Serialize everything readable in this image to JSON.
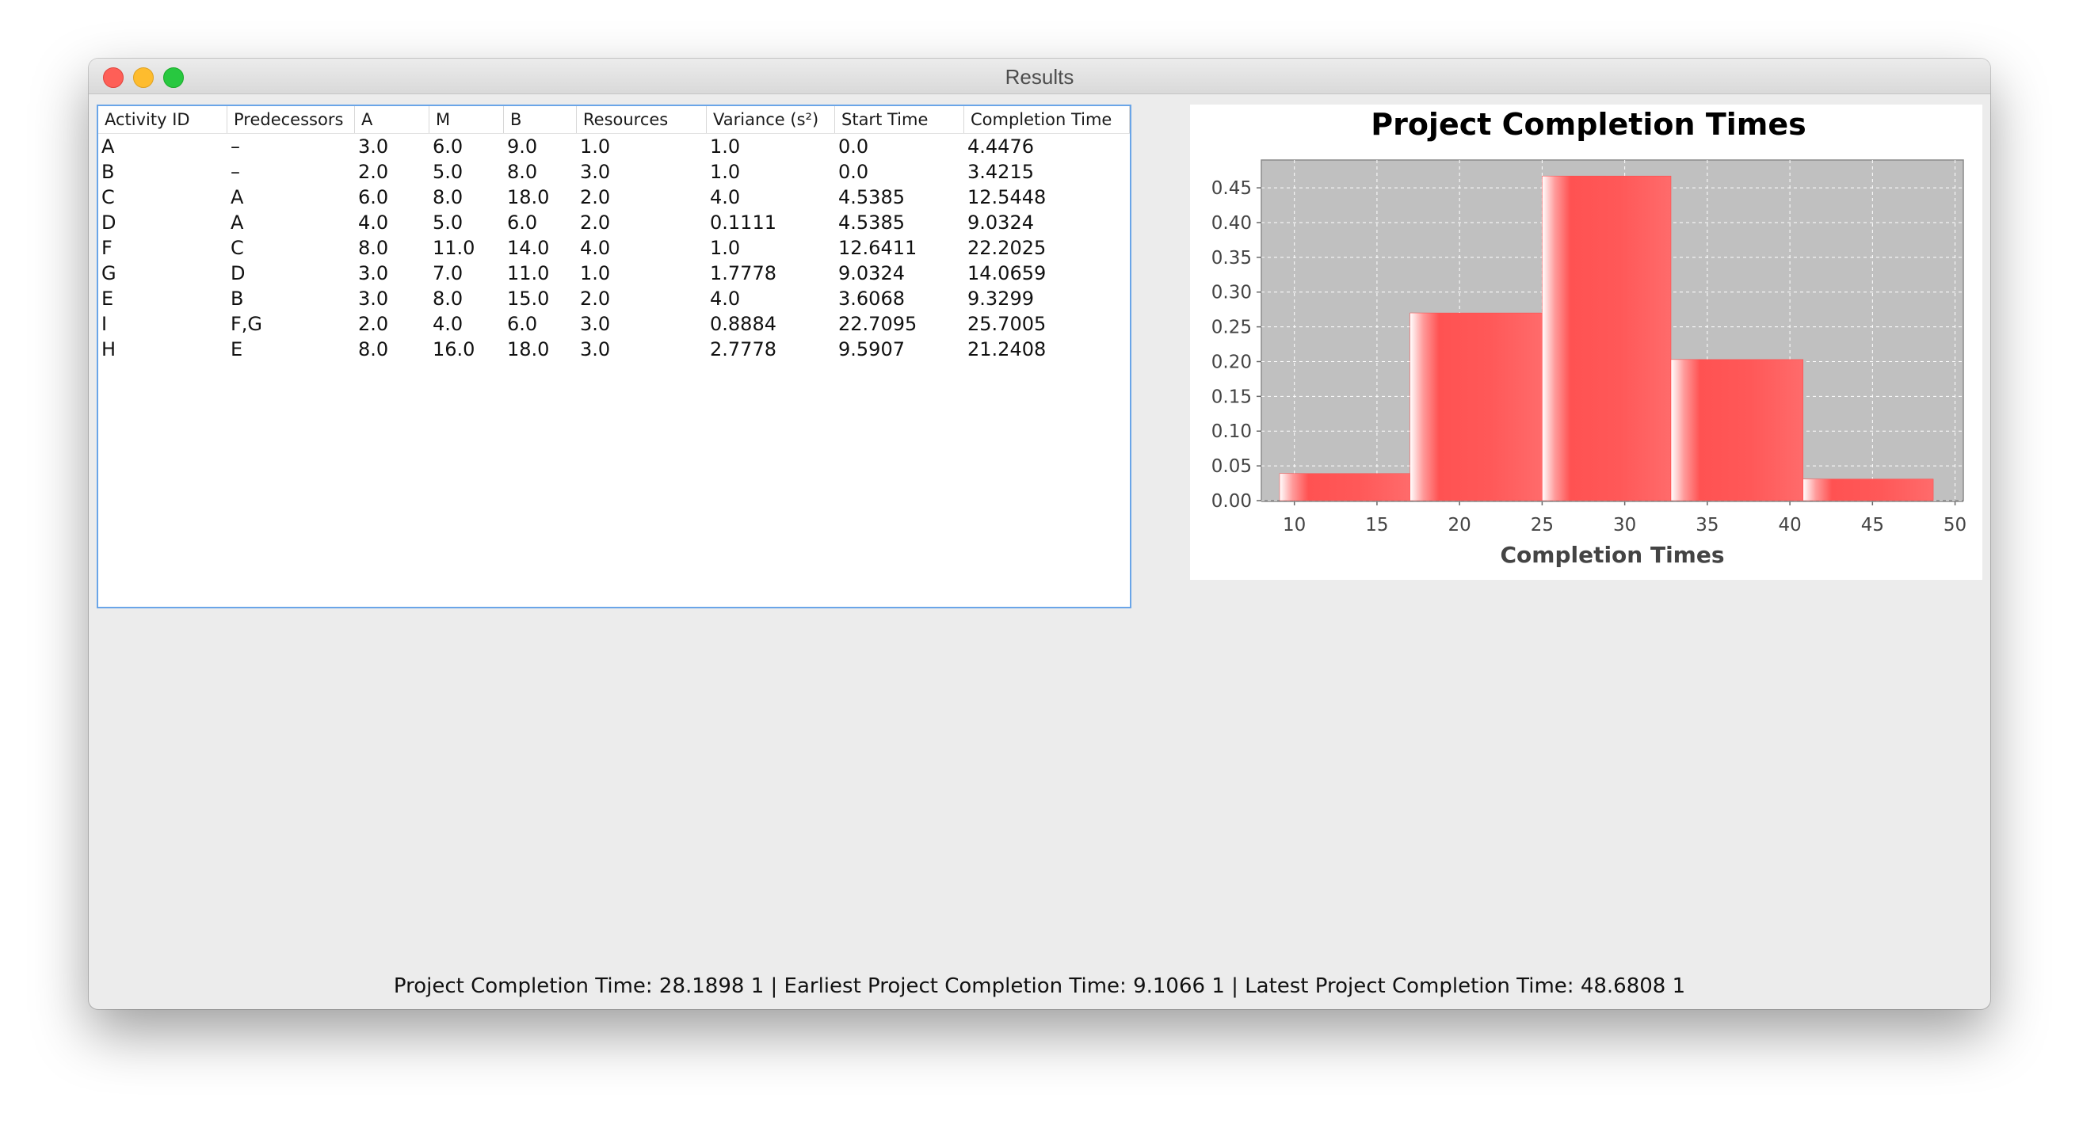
{
  "window": {
    "title": "Results"
  },
  "table": {
    "headers": [
      "Activity ID",
      "Predecessors",
      "A",
      "M",
      "B",
      "Resources",
      "Variance (s²)",
      "Start Time",
      "Completion Time"
    ],
    "rows": [
      [
        "A",
        "–",
        "3.0",
        "6.0",
        "9.0",
        "1.0",
        "1.0",
        "0.0",
        "4.4476"
      ],
      [
        "B",
        "–",
        "2.0",
        "5.0",
        "8.0",
        "3.0",
        "1.0",
        "0.0",
        "3.4215"
      ],
      [
        "C",
        "A",
        "6.0",
        "8.0",
        "18.0",
        "2.0",
        "4.0",
        "4.5385",
        "12.5448"
      ],
      [
        "D",
        "A",
        "4.0",
        "5.0",
        "6.0",
        "2.0",
        "0.1111",
        "4.5385",
        "9.0324"
      ],
      [
        "F",
        "C",
        "8.0",
        "11.0",
        "14.0",
        "4.0",
        "1.0",
        "12.6411",
        "22.2025"
      ],
      [
        "G",
        "D",
        "3.0",
        "7.0",
        "11.0",
        "1.0",
        "1.7778",
        "9.0324",
        "14.0659"
      ],
      [
        "E",
        "B",
        "3.0",
        "8.0",
        "15.0",
        "2.0",
        "4.0",
        "3.6068",
        "9.3299"
      ],
      [
        "I",
        "F,G",
        "2.0",
        "4.0",
        "6.0",
        "3.0",
        "0.8884",
        "22.7095",
        "25.7005"
      ],
      [
        "H",
        "E",
        "8.0",
        "16.0",
        "18.0",
        "3.0",
        "2.7778",
        "9.5907",
        "21.2408"
      ]
    ]
  },
  "chart_data": {
    "type": "bar",
    "title": "Project Completion Times",
    "xlabel": "Completion Times",
    "ylabel": "",
    "bins": [
      {
        "start": 9.1066,
        "end": 17.0,
        "value": 0.039
      },
      {
        "start": 17.0,
        "end": 25.0,
        "value": 0.27
      },
      {
        "start": 25.0,
        "end": 32.8,
        "value": 0.467
      },
      {
        "start": 32.8,
        "end": 40.8,
        "value": 0.203
      },
      {
        "start": 40.8,
        "end": 48.6808,
        "value": 0.031
      }
    ],
    "xlim": [
      8,
      50.5
    ],
    "ylim": [
      0,
      0.49
    ],
    "xticks": [
      10,
      15,
      20,
      25,
      30,
      35,
      40,
      45,
      50
    ],
    "yticks": [
      0.0,
      0.05,
      0.1,
      0.15,
      0.2,
      0.25,
      0.3,
      0.35,
      0.4,
      0.45
    ],
    "grid": true,
    "colors": {
      "bar": "#ff5555",
      "plot_bg": "#c0c0c0",
      "grid": "#ffffff"
    }
  },
  "status": {
    "text": "Project Completion Time: 28.1898 1 | Earliest Project Completion Time: 9.1066 1 | Latest Project Completion Time: 48.6808 1"
  }
}
